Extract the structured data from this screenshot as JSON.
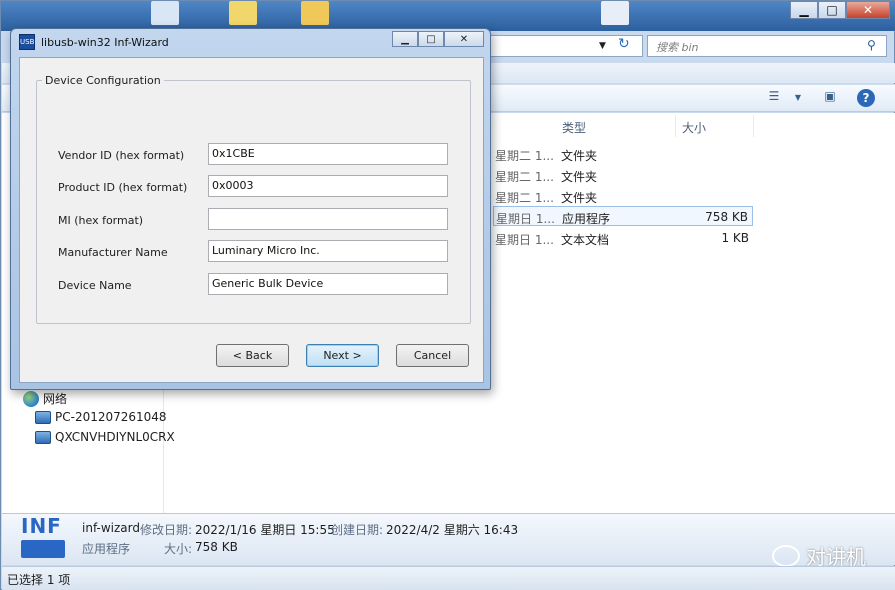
{
  "explorer": {
    "search_placeholder": "搜索 bin",
    "columns": {
      "type": "类型",
      "size": "大小"
    },
    "files": [
      {
        "date": "星期二 1...",
        "type": "文件夹",
        "size": ""
      },
      {
        "date": "星期二 1...",
        "type": "文件夹",
        "size": ""
      },
      {
        "date": "星期二 1...",
        "type": "文件夹",
        "size": ""
      },
      {
        "date": "星期日 1...",
        "type": "应用程序",
        "size": "758 KB"
      },
      {
        "date": "星期日 1...",
        "type": "文本文档",
        "size": "1 KB"
      }
    ],
    "nav": {
      "network": "网络",
      "computers": [
        "PC-201207261048",
        "QXCNVHDIYNL0CRX"
      ]
    },
    "details": {
      "icon_text": "INF",
      "name": "inf-wizard",
      "modified_label": "修改日期:",
      "modified_value": "2022/1/16 星期日 15:55",
      "created_label": "创建日期:",
      "created_value": "2022/4/2 星期六 16:43",
      "type": "应用程序",
      "size_label": "大小:",
      "size_value": "758 KB"
    },
    "status": "已选择 1 项",
    "watermark": "对讲机"
  },
  "wizard": {
    "title": "libusb-win32 Inf-Wizard",
    "group_label": "Device Configuration",
    "fields": [
      {
        "label": "Vendor ID (hex format)",
        "value": "0x1CBE"
      },
      {
        "label": "Product ID (hex format)",
        "value": "0x0003"
      },
      {
        "label": "MI (hex format)",
        "value": ""
      },
      {
        "label": "Manufacturer Name",
        "value": "Luminary Micro Inc."
      },
      {
        "label": "Device Name",
        "value": "Generic Bulk Device"
      }
    ],
    "buttons": {
      "back": "< Back",
      "next": "Next >",
      "cancel": "Cancel"
    }
  }
}
